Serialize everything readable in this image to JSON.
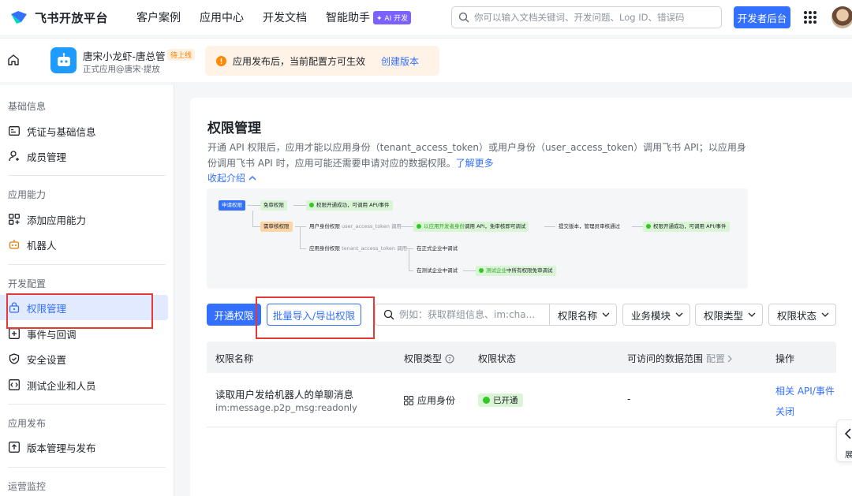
{
  "topbar": {
    "logo_text": "飞书开放平台",
    "nav": [
      "客户案例",
      "应用中心",
      "开发文档",
      "智能助手"
    ],
    "ai_badge": "AI 开发",
    "search_placeholder": "你可以输入文档关键词、开发问题、Log ID、错误码",
    "dev_button": "开发者后台"
  },
  "appbar": {
    "app_name": "唐宋小龙虾-唐总管",
    "app_status": "待上线",
    "app_sub": "正式应用@唐宋·提放",
    "notice_text": "应用发布后，当前配置方可生效",
    "notice_link": "创建版本"
  },
  "sidebar": {
    "sections": [
      {
        "title": "基础信息",
        "items": [
          "凭证与基础信息",
          "成员管理"
        ]
      },
      {
        "title": "应用能力",
        "items": [
          "添加应用能力",
          "机器人"
        ]
      },
      {
        "title": "开发配置",
        "items": [
          "权限管理",
          "事件与回调",
          "安全设置",
          "测试企业和人员"
        ]
      },
      {
        "title": "应用发布",
        "items": [
          "版本管理与发布"
        ]
      },
      {
        "title": "运营监控",
        "items": []
      }
    ],
    "active_item": "权限管理"
  },
  "main": {
    "title": "权限管理",
    "desc": "开通 API 权限后，应用才能以应用身份（tenant_access_token）或用户身份（user_access_token）调用飞书 API；以应用身份调用飞书 API 时，应用可能还需要申请对应的数据权限。",
    "learn_more": "了解更多",
    "collapse": "收起介绍",
    "flow": {
      "apply": "申请权限",
      "free": "免审权限",
      "free_result": "权限开通成功，可调用 API/事件",
      "review": "需审核权限",
      "user_perm": "用户身份权限",
      "user_token": "user_access_token 调用",
      "user_result_a": "以应用开发者身份",
      "user_result_b": "调用 API，免审核即可调试",
      "submit": "提交版本，管理员审核通过",
      "final_result": "权限开通成功，可调用 API/事件",
      "app_perm": "应用身份权限",
      "tenant_token": "tenant_access_token 调用",
      "prod_debug": "在正式企业中调试",
      "test_debug": "在测试企业中调试",
      "test_result_a": "测试企业",
      "test_result_b": "中所有权限免审调试"
    },
    "toolbar": {
      "enable": "开通权限",
      "batch": "批量导入/导出权限",
      "search_placeholder": "例如：获取群组信息、im:cha...",
      "filters": [
        "权限名称",
        "业务模块",
        "权限类型",
        "权限状态"
      ]
    },
    "table": {
      "headers": [
        "权限名称",
        "权限类型",
        "权限状态",
        "可访问的数据范围",
        "配置",
        "操作"
      ],
      "rows": [
        {
          "name": "读取用户发给机器人的单聊消息",
          "code": "im:message.p2p_msg:readonly",
          "type": "应用身份",
          "status": "已开通",
          "range": "-",
          "ops": [
            "相关 API/事件",
            "关闭"
          ]
        }
      ]
    },
    "float_label": "展"
  },
  "colors": {
    "primary": "#3370ff",
    "highlight_box": "#e53935",
    "success": "#34c724"
  }
}
